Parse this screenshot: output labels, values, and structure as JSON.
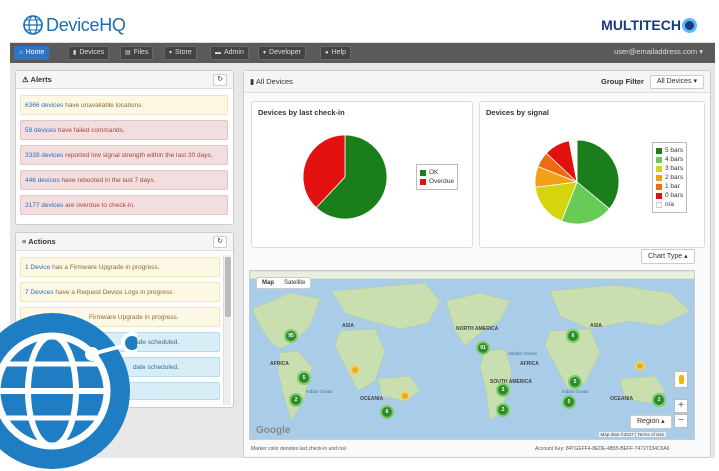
{
  "header": {
    "app_name": "DeviceHQ",
    "brand": "MULTITECH"
  },
  "nav": {
    "items": [
      {
        "label": "Home",
        "icon": "home-icon",
        "active": true
      },
      {
        "label": "Devices",
        "icon": "chart-icon",
        "active": false
      },
      {
        "label": "Files",
        "icon": "file-icon",
        "active": false
      },
      {
        "label": "Store",
        "icon": "cart-icon",
        "active": false
      },
      {
        "label": "Admin",
        "icon": "briefcase-icon",
        "active": false
      },
      {
        "label": "Developer",
        "icon": "cart-icon",
        "active": false
      },
      {
        "label": "Help",
        "icon": "question-icon",
        "active": false
      }
    ],
    "user": "user@emailaddress.com"
  },
  "alerts": {
    "title": "Alerts",
    "items": [
      {
        "count": "6366 devices",
        "text": " have unavailable locations.",
        "type": "warn"
      },
      {
        "count": "59 devices",
        "text": " have failed commands.",
        "type": "err"
      },
      {
        "count": "3339 devices",
        "text": " reported low signal strength within the last 30 days.",
        "type": "err"
      },
      {
        "count": "446 devices",
        "text": " have rebooted in the last 7 days.",
        "type": "err"
      },
      {
        "count": "3177 devices",
        "text": " are overdue to check-in.",
        "type": "err"
      }
    ]
  },
  "actions": {
    "title": "Actions",
    "items": [
      {
        "count": "1 Device",
        "text": " has a Firmware Upgrade in progress.",
        "type": "warn"
      },
      {
        "count": "7 Devices",
        "text": " have a Request Device Logs in progress.",
        "type": "warn"
      },
      {
        "count": "",
        "text": "Firmware Upgrade in progress.",
        "type": "warn"
      },
      {
        "count": "",
        "text": "Upgrade scheduled.",
        "type": "info"
      },
      {
        "count": "",
        "text": "date scheduled.",
        "type": "info"
      }
    ]
  },
  "devices_panel": {
    "title": "All Devices",
    "group_filter_label": "Group Filter",
    "group_filter_value": "All Devices"
  },
  "checkin_chart": {
    "title": "Devices by last check-in",
    "legend": [
      {
        "label": "OK",
        "color": "#1a7f1a"
      },
      {
        "label": "Overdue",
        "color": "#e31010"
      }
    ]
  },
  "signal_chart": {
    "title": "Devices by signal",
    "legend": [
      {
        "label": "5 bars",
        "color": "#1a7f1a"
      },
      {
        "label": "4 bars",
        "color": "#66cc55"
      },
      {
        "label": "3 bars",
        "color": "#d4d40f"
      },
      {
        "label": "2 bars",
        "color": "#f2a01a"
      },
      {
        "label": "1 bar",
        "color": "#f06a10"
      },
      {
        "label": "0 bars",
        "color": "#e31010"
      },
      {
        "label": "n/a",
        "color": "#ffffff"
      }
    ]
  },
  "chart_data": [
    {
      "type": "pie",
      "title": "Devices by last check-in",
      "categories": [
        "OK",
        "Overdue"
      ],
      "values": [
        62,
        38
      ],
      "colors": [
        "#1a7f1a",
        "#e31010"
      ]
    },
    {
      "type": "pie",
      "title": "Devices by signal",
      "categories": [
        "5 bars",
        "4 bars",
        "3 bars",
        "2 bars",
        "1 bar",
        "0 bars",
        "n/a"
      ],
      "values": [
        36,
        20,
        17,
        8,
        6,
        10,
        3
      ],
      "colors": [
        "#1a7f1a",
        "#66cc55",
        "#d4d40f",
        "#f2a01a",
        "#f06a10",
        "#e31010",
        "#ffffff"
      ]
    }
  ],
  "chart_type_button": "Chart Type",
  "map": {
    "tabs": [
      "Map",
      "Satellite"
    ],
    "region_button": "Region",
    "attribution": "Map data ©2017",
    "terms": "Terms of Use",
    "google": "Google",
    "labels": {
      "asia": "ASIA",
      "africa": "AFRICA",
      "oceania": "OCEANIA",
      "north_america": "NORTH AMERICA",
      "south_america": "SOUTH AMERICA",
      "atlantic": "Atlantic Ocean",
      "indian": "Indian Ocean"
    },
    "clusters": [
      "95",
      "5",
      "2",
      "6",
      "3",
      "5",
      "2",
      "91",
      "5",
      "6",
      "5",
      "5",
      "2"
    ]
  },
  "footer": {
    "note": "Marker color denotes last check-in and rssi",
    "account": "Account Key: 84TGEFF4-8EDE-4B55-BEFF-74727334C6A6"
  }
}
